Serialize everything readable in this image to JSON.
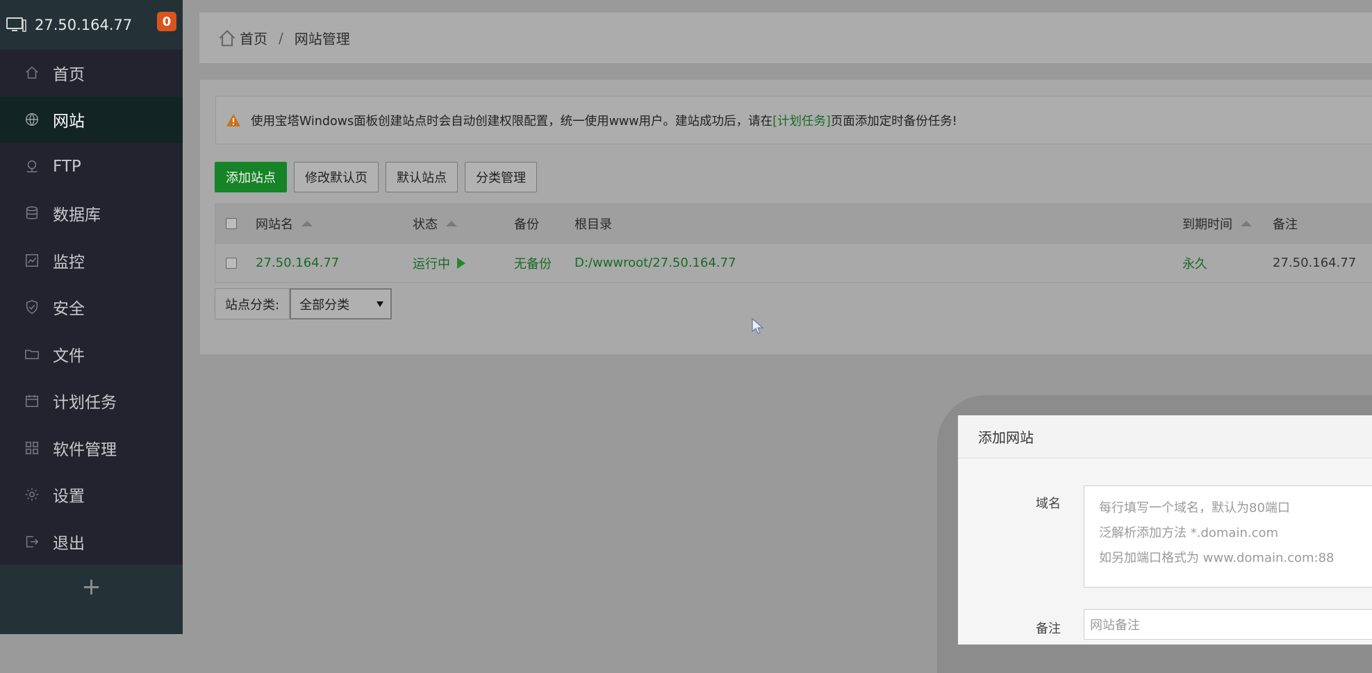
{
  "sidebar": {
    "ip": "27.50.164.77",
    "badge": "0",
    "items": [
      {
        "label": "首页",
        "icon": "home-icon"
      },
      {
        "label": "网站",
        "icon": "globe-icon"
      },
      {
        "label": "FTP",
        "icon": "ftp-icon"
      },
      {
        "label": "数据库",
        "icon": "database-icon"
      },
      {
        "label": "监控",
        "icon": "monitor-icon"
      },
      {
        "label": "安全",
        "icon": "shield-icon"
      },
      {
        "label": "文件",
        "icon": "folder-icon"
      },
      {
        "label": "计划任务",
        "icon": "calendar-icon"
      },
      {
        "label": "软件管理",
        "icon": "grid-icon"
      },
      {
        "label": "设置",
        "icon": "gear-icon"
      },
      {
        "label": "退出",
        "icon": "logout-icon"
      }
    ],
    "active": "网站",
    "add": "+"
  },
  "breadcrumb": {
    "home": "首页",
    "sep": "/",
    "current": "网站管理"
  },
  "notice": {
    "before": "使用宝塔Windows面板创建站点时会自动创建权限配置，统一使用www用户。建站成功后，请在",
    "link": "[计划任务]",
    "after": "页面添加定时备份任务!"
  },
  "buttons": {
    "add": "添加站点",
    "modify_default": "修改默认页",
    "default_site": "默认站点",
    "category": "分类管理"
  },
  "table": {
    "headers": {
      "name": "网站名",
      "status": "状态",
      "backup": "备份",
      "root": "根目录",
      "expire": "到期时间",
      "note": "备注"
    },
    "rows": [
      {
        "name": "27.50.164.77",
        "status": "运行中",
        "backup": "无备份",
        "root": "D:/wwwroot/27.50.164.77",
        "expire": "永久",
        "note": "27.50.164.77"
      }
    ]
  },
  "filter": {
    "label": "站点分类:",
    "selected": "全部分类"
  },
  "modal": {
    "title": "添加网站",
    "domain_label": "域名",
    "domain_placeholder_lines": [
      "每行填写一个域名，默认为80端口",
      "泛解析添加方法 *.domain.com",
      "如另加端口格式为 www.domain.com:88"
    ],
    "note_label": "备注",
    "note_placeholder": "网站备注"
  },
  "colors": {
    "sidebar_bg": "#23232f",
    "primary_green": "#168326",
    "badge": "#d9541e"
  }
}
